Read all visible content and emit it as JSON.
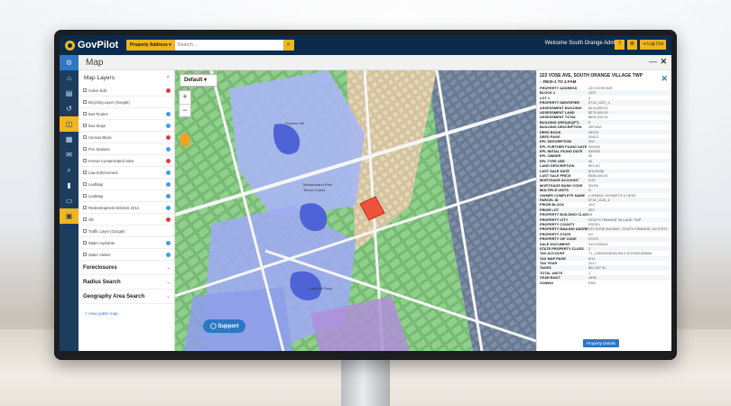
{
  "app": {
    "logo": "GovPilot"
  },
  "topbar": {
    "property_select": "Property Address ▾",
    "search_placeholder": "Search ...",
    "search_icon": "search-icon",
    "welcome": "Welcome South Orange Admin",
    "logout": "Log Out"
  },
  "header": {
    "title": "Map"
  },
  "rail": {
    "icons": [
      "gear-icon",
      "home-icon",
      "document-icon",
      "history-icon",
      "map-icon",
      "calendar-icon",
      "inbox-icon",
      "search-icon",
      "chart-icon",
      "folder-icon",
      "contact-card-icon"
    ]
  },
  "layers": {
    "title": "Map Layers",
    "items": [
      {
        "label": "Active Edit",
        "status": "red"
      },
      {
        "label": "Bicycling Layer (Google)",
        "status": "none"
      },
      {
        "label": "Bus Routes",
        "status": "blue"
      },
      {
        "label": "Bus Stops",
        "status": "blue"
      },
      {
        "label": "Census Block",
        "status": "red"
      },
      {
        "label": "Fire Stations",
        "status": "blue"
      },
      {
        "label": "Known Contaminated Sites",
        "status": "red"
      },
      {
        "label": "Law Enforcement",
        "status": "blue"
      },
      {
        "label": "LeafMap",
        "status": "blue"
      },
      {
        "label": "LeafMap",
        "status": "blue"
      },
      {
        "label": "Redevelopment Districts 2014",
        "status": "blue"
      },
      {
        "label": "SD",
        "status": "red"
      },
      {
        "label": "Traffic Layer (Google)",
        "status": "none"
      },
      {
        "label": "Water Hydrants",
        "status": "blue"
      },
      {
        "label": "Water Valves",
        "status": "blue"
      }
    ],
    "sections": [
      {
        "label": "Foreclosures"
      },
      {
        "label": "Radius Search"
      },
      {
        "label": "Geography Area Search"
      }
    ],
    "view_public": "View public map"
  },
  "map": {
    "basemap": "Default",
    "zoom_in": "+",
    "zoom_out": "−",
    "labels": [
      "Flowers Hill",
      "Meadowland Park",
      "Tennis Courts",
      "Diamond Rock"
    ]
  },
  "details": {
    "title": "223 VOSE AVE, SOUTH ORANGE VILLAGE TWP",
    "subtitle": "RESI-1 TO 4 FAM",
    "rows": [
      {
        "k": "PROPERTY ADDRESS",
        "v": "223 VOSE AVE"
      },
      {
        "k": "BLOCK 1",
        "v": "1207"
      },
      {
        "k": "LOT 1",
        "v": "4"
      },
      {
        "k": "PROPERTY IDENTIFIER",
        "v": "0715_1207_4"
      },
      {
        "k": "ASSESSMENT BUILDING",
        "v": "$418,800.00"
      },
      {
        "k": "ASSESSMENT LAND",
        "v": "$275,400.00"
      },
      {
        "k": "ASSESSMENT TOTAL",
        "v": "$694,200.00"
      },
      {
        "k": "BUILDING AREA(SQFT)",
        "v": "0"
      },
      {
        "k": "BUILDING DESCRIPTION",
        "v": "25FZAG"
      },
      {
        "k": "DEED BOOK",
        "v": "06376"
      },
      {
        "k": "DEED PAGE",
        "v": "00813"
      },
      {
        "k": "EPL DESCRIPTION",
        "v": "000"
      },
      {
        "k": "EPL FURTHER FILING DATE",
        "v": "000000"
      },
      {
        "k": "EPL INITIAL FILING DATE",
        "v": "000000"
      },
      {
        "k": "EPL OWNER",
        "v": "00"
      },
      {
        "k": "EPL TYPE USE",
        "v": "00"
      },
      {
        "k": "LAND DESCRIPTION",
        "v": "50X AC"
      },
      {
        "k": "LAST SALE DATE",
        "v": "8/11/2006"
      },
      {
        "k": "LAST SALE PRICE",
        "v": "$385,000.00"
      },
      {
        "k": "MORTGAGE ACCOUNT",
        "v": "0.00"
      },
      {
        "k": "MORTGAGE BANK CODE",
        "v": "00000"
      },
      {
        "k": "MULTIPLE UNITS",
        "v": "N"
      },
      {
        "k": "OWNER COMPLETE NAME",
        "v": "LORMAN, KENNETH & HEIDI"
      },
      {
        "k": "PARCEL ID",
        "v": "0715_1120_4"
      },
      {
        "k": "PRIOR BLOCK",
        "v": "100"
      },
      {
        "k": "PRIOR LOT",
        "v": "320"
      },
      {
        "k": "PROPERTY BUILDING CLASS",
        "v": "15"
      },
      {
        "k": "PROPERTY CITY",
        "v": "SOUTH ORANGE VILLAGE TWP"
      },
      {
        "k": "PROPERTY COUNTY",
        "v": "ESSEX"
      },
      {
        "k": "PROPERTY MAILING ADDRESS",
        "v": "223 VOSE AVENUE, SOUTH ORANGE, NJ 07079"
      },
      {
        "k": "PROPERTY STATE",
        "v": "NJ"
      },
      {
        "k": "PROPERTY ZIP CODE",
        "v": "07079"
      },
      {
        "k": "SALE DOCUMENT",
        "v": "0107100443"
      },
      {
        "k": "STATE PROPERTY CLASS",
        "v": "2"
      },
      {
        "k": "TAX ACCOUNT",
        "v": "71_1350434461813513 4070000345606"
      },
      {
        "k": "TAX MAP PAGE",
        "v": "M12"
      },
      {
        "k": "TAX YEAR",
        "v": "2017"
      },
      {
        "k": "TAXES",
        "v": "$22,637.31"
      },
      {
        "k": "TOTAL UNITS",
        "v": "1"
      },
      {
        "k": "YEAR BUILT",
        "v": "1896"
      },
      {
        "k": "ZONING",
        "v": "RSD"
      }
    ],
    "button": "Property Details"
  },
  "support": {
    "label": "Support"
  }
}
